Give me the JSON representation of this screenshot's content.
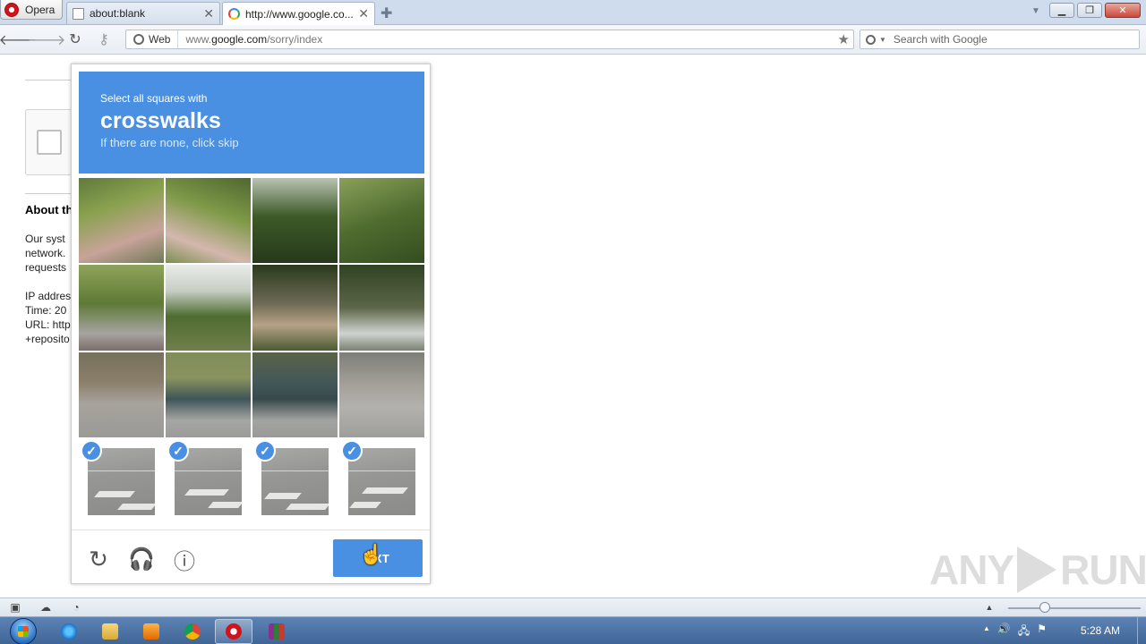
{
  "browser": {
    "menu_label": "Opera",
    "tabs": [
      {
        "title": "about:blank"
      },
      {
        "title": "http://www.google.co..."
      }
    ],
    "address": {
      "mode_label": "Web",
      "url_prefix": "www.",
      "url_domain": "google.com",
      "url_path": "/sorry/index"
    },
    "search_placeholder": "Search with Google"
  },
  "page": {
    "about_title": "About th",
    "about_lines": [
      "Our syst",
      "network.",
      "requests"
    ],
    "info_lines": [
      "IP addres",
      "Time: 20",
      "URL: http",
      "+reposito"
    ]
  },
  "captcha": {
    "instruction_prefix": "Select all squares with",
    "target": "crosswalks",
    "hint": "If there are none, click skip",
    "next_label": "EXT",
    "selected_count": 4,
    "colors": {
      "accent": "#4a90e2"
    }
  },
  "watermark": {
    "left": "ANY",
    "right": "RUN"
  },
  "taskbar": {
    "clock": "5:28 AM"
  }
}
